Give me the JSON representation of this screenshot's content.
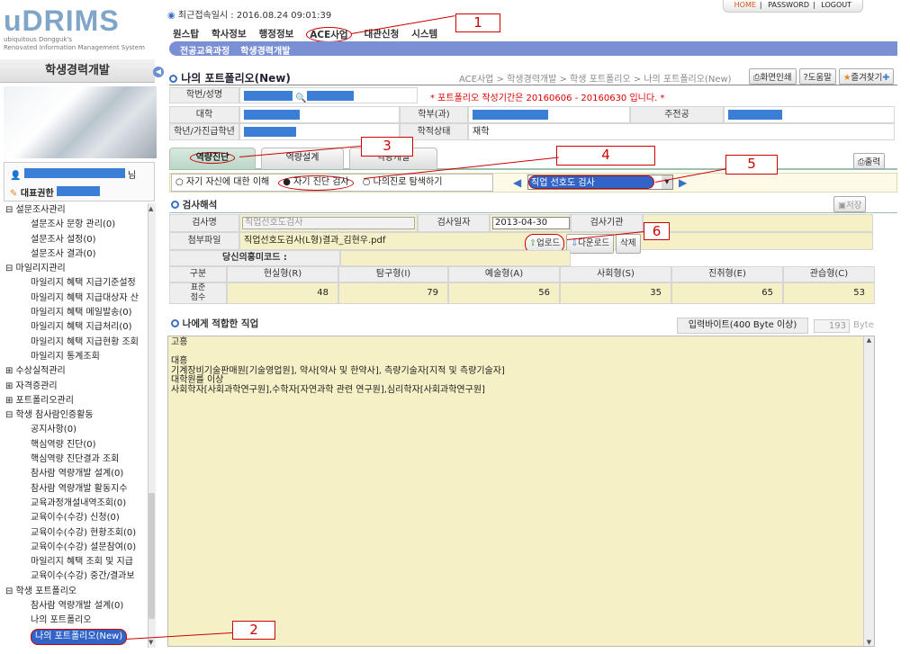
{
  "header": {
    "logo": "uDRIMS",
    "logo_sub1": "ubiquitous Dongguk's",
    "logo_sub2": "Renovated Information Management System",
    "last_login": "최근접속일시 : 2016.08.24 09:01:39",
    "top_links": [
      "HOME",
      "PASSWORD",
      "LOGOUT"
    ],
    "main_menu": [
      "원스탑",
      "학사정보",
      "행정정보",
      "ACE사업",
      "대관신청",
      "시스템"
    ],
    "sub_menu": [
      "전공교육과정",
      "학생경력개발"
    ]
  },
  "sidebar": {
    "title": "학생경력개발",
    "user_suffix": "님",
    "rep_auth": "대표권한",
    "tree": [
      {
        "t": "g",
        "label": "⊟ 설문조사관리"
      },
      {
        "t": "c",
        "label": "설문조사 문항 관리(0)"
      },
      {
        "t": "c",
        "label": "설문조사 설정(0)"
      },
      {
        "t": "c",
        "label": "설문조사 결과(0)"
      },
      {
        "t": "g",
        "label": "⊟ 마일리지관리"
      },
      {
        "t": "c",
        "label": "마일리지 혜택 지급기준설정"
      },
      {
        "t": "c",
        "label": "마일리지 혜택 지급대상자 산"
      },
      {
        "t": "c",
        "label": "마일리지 혜택 메일발송(0)"
      },
      {
        "t": "c",
        "label": "마일리지 혜택 지급처리(0)"
      },
      {
        "t": "c",
        "label": "마일리지 혜택 지급현황 조회"
      },
      {
        "t": "c",
        "label": "마일리지 통계조회"
      },
      {
        "t": "g",
        "label": "⊞ 수상실적관리"
      },
      {
        "t": "g",
        "label": "⊞ 자격증관리"
      },
      {
        "t": "g",
        "label": "⊞ 포트폴리오관리"
      },
      {
        "t": "g",
        "label": "⊟ 학생 참사람인증활동"
      },
      {
        "t": "c",
        "label": "공지사항(0)"
      },
      {
        "t": "c",
        "label": "핵심역량 진단(0)"
      },
      {
        "t": "c",
        "label": "핵심역량 진단결과 조회"
      },
      {
        "t": "c",
        "label": "참사람 역량개발 설계(0)"
      },
      {
        "t": "c",
        "label": "참사람 역량개발 활동지수"
      },
      {
        "t": "c",
        "label": "교육과정개설내역조회(0)"
      },
      {
        "t": "c",
        "label": "교육이수(수강) 신청(0)"
      },
      {
        "t": "c",
        "label": "교육이수(수강) 현황조회(0)"
      },
      {
        "t": "c",
        "label": "교육이수(수강) 설문참여(0)"
      },
      {
        "t": "c",
        "label": "마일리지 혜택 조회 및 지급"
      },
      {
        "t": "c",
        "label": "교육이수(수강) 중간/결과보"
      },
      {
        "t": "g",
        "label": "⊟ 학생 포트폴리오"
      },
      {
        "t": "c",
        "label": "참사람 역량개발 설계(0)"
      },
      {
        "t": "c",
        "label": "나의 포트폴리오"
      },
      {
        "t": "s",
        "label": "나의 포트폴리오(New)"
      }
    ]
  },
  "page": {
    "title": "나의 포트폴리오(New)",
    "breadcrumb": "ACE사업 > 학생경력개발 > 학생 포트폴리오 > 나의 포트폴리오(New)",
    "buttons": [
      "화면인쇄",
      "도움말",
      "즐겨찾기"
    ],
    "notice": "* 포트폴리오  작성기간은 20160606 - 20160630 입니다. *",
    "info": {
      "studentid_label": "학번/성명",
      "college_label": "대학",
      "dept_label": "학부(과)",
      "major_label": "주전공",
      "grade_label": "학년/가진급학년",
      "status_label": "학적상태",
      "status_value": "재학"
    },
    "tabs": [
      "역량진단",
      "역량설계",
      "역량개발"
    ],
    "print_button": "출력",
    "radios": [
      "자기 자신에 대한 이해",
      "자기 진단 검사",
      "나의진로 탐색하기"
    ],
    "test_select": "직업 선호도 검사",
    "save_button": "저장",
    "exam": {
      "section_title": "검사해석",
      "name_label": "검사명",
      "name_value": "직업선호도검사",
      "date_label": "검사일자",
      "date_value": "2013-04-30",
      "agency_label": "검사기관",
      "file_label": "첨부파일",
      "file_value": "직업선호도검사(L형)결과_김현우.pdf",
      "upload_button": "업로드",
      "download_button": "다운로드",
      "delete_button": "삭제",
      "interest_label": "당신의흥미코드 :"
    },
    "scores": {
      "header": [
        "구분",
        "현실형(R)",
        "탐구형(I)",
        "예술형(A)",
        "사회형(S)",
        "진취형(E)",
        "관습형(C)"
      ],
      "row_label": "표준점수",
      "values": [
        "48",
        "79",
        "56",
        "35",
        "65",
        "53"
      ]
    },
    "jobs": {
      "section_title": "나에게 적합한 직업",
      "byte_label": "입력바이트(400 Byte 이상)",
      "byte_count": "193",
      "byte_unit": "Byte",
      "lines": [
        "고흥",
        "",
        "대흥",
        "기계장비기술판매원[기술영업원], 약사[약사 및 한약사], 측량기술자[지적 및 측량기술자]",
        "대학원를 이상",
        "사회학자[사회과학연구원],수학자[자연과학 관련 연구원],심리학자[사회과학연구원]"
      ]
    }
  },
  "annotations": [
    "1",
    "2",
    "3",
    "4",
    "5",
    "6"
  ]
}
